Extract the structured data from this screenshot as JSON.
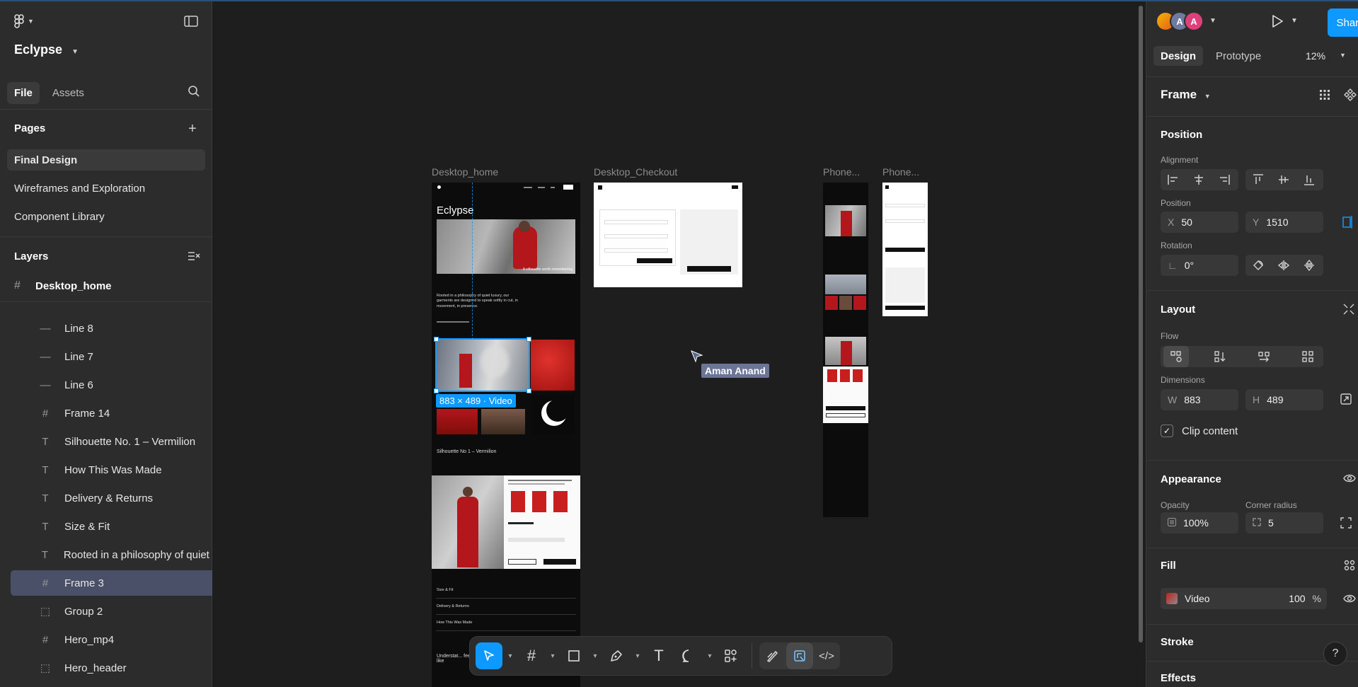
{
  "app": {
    "file_name": "Eclypse"
  },
  "left": {
    "tabs": [
      "File",
      "Assets"
    ],
    "pages_title": "Pages",
    "pages": [
      "Final Design",
      "Wireframes and Exploration",
      "Component Library"
    ],
    "layers_title": "Layers",
    "root_layer": "Desktop_home",
    "layers": [
      {
        "icon": "line",
        "name": "Line 8"
      },
      {
        "icon": "line",
        "name": "Line 7"
      },
      {
        "icon": "line",
        "name": "Line 6"
      },
      {
        "icon": "frame",
        "name": "Frame 14"
      },
      {
        "icon": "text",
        "name": "Silhouette No. 1 – Vermilion"
      },
      {
        "icon": "text",
        "name": "How This Was Made"
      },
      {
        "icon": "text",
        "name": "Delivery & Returns"
      },
      {
        "icon": "text",
        "name": "Size & Fit"
      },
      {
        "icon": "text",
        "name": "Rooted in a philosophy of quiet lu"
      },
      {
        "icon": "frame",
        "name": "Frame 3"
      },
      {
        "icon": "group",
        "name": "Group 2"
      },
      {
        "icon": "frame",
        "name": "Hero_mp4"
      },
      {
        "icon": "group",
        "name": "Hero_header"
      }
    ]
  },
  "canvas": {
    "frames": [
      "Desktop_home",
      "Desktop_Checkout",
      "Phone...",
      "Phone..."
    ],
    "home": {
      "brand": "Eclypse",
      "caption": "A silhouette worth remembering",
      "paragraph": "Rooted in a philosophy of quiet luxury, our garments are designed to speak softly in cut, in movement, in presence.",
      "product_title": "Silhouette No 1 – Vermilion",
      "accordions": [
        "Size & Fit",
        "Delivery & Returns",
        "How This Was Made"
      ],
      "quote": "Understat... feels like"
    },
    "selection_badge": "883 × 489 · Video",
    "cursor_user": "Aman Anand"
  },
  "toolbar": {
    "tools": [
      "move-tool",
      "frame-tool",
      "shape-tool",
      "pen-tool",
      "text-tool",
      "comment-tool",
      "actions-tool",
      "draw-mode",
      "design-mode",
      "dev-mode"
    ]
  },
  "right": {
    "avatars": [
      "A",
      "A"
    ],
    "share_label": "Share",
    "tabs": [
      "Design",
      "Prototype"
    ],
    "zoom": "12%",
    "frame_label": "Frame",
    "position_title": "Position",
    "alignment_label": "Alignment",
    "position_label": "Position",
    "x_label": "X",
    "x_value": "50",
    "y_label": "Y",
    "y_value": "1510",
    "rotation_label": "Rotation",
    "rotation_value": "0°",
    "layout_title": "Layout",
    "flow_label": "Flow",
    "dimensions_label": "Dimensions",
    "w_label": "W",
    "w_value": "883",
    "h_label": "H",
    "h_value": "489",
    "clip_label": "Clip content",
    "appearance_title": "Appearance",
    "opacity_label": "Opacity",
    "opacity_value": "100%",
    "radius_label": "Corner radius",
    "radius_value": "5",
    "fill_title": "Fill",
    "fill_type": "Video",
    "fill_opacity": "100",
    "fill_unit": "%",
    "stroke_title": "Stroke",
    "effects_title": "Effects",
    "help": "?"
  },
  "colors": {
    "accent": "#0d99ff",
    "panel": "#2c2c2c",
    "canvas": "#1e1e1e",
    "selected_layer": "#4a5068",
    "brand_red": "#c81e1e"
  }
}
